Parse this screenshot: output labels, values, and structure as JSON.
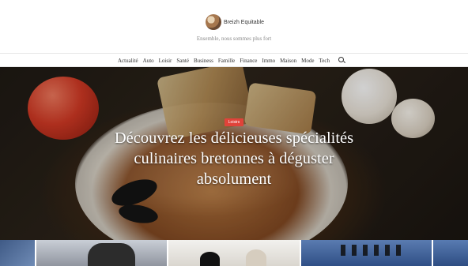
{
  "site": {
    "name": "Breizh Equitable",
    "tagline": "Ensemble, nous sommes plus fort"
  },
  "nav": {
    "items": [
      "Actualité",
      "Auto",
      "Loisir",
      "Santé",
      "Business",
      "Famille",
      "Finance",
      "Immo",
      "Maison",
      "Mode",
      "Tech"
    ],
    "search_icon": "search-icon"
  },
  "hero": {
    "category": "Loisirs",
    "title": "Découvrez les délicieuses spécialités culinaires bretonnes à déguster absolument"
  },
  "colors": {
    "badge": "#e0433a",
    "nav_text": "#333333",
    "tagline": "#8a8a8a"
  }
}
